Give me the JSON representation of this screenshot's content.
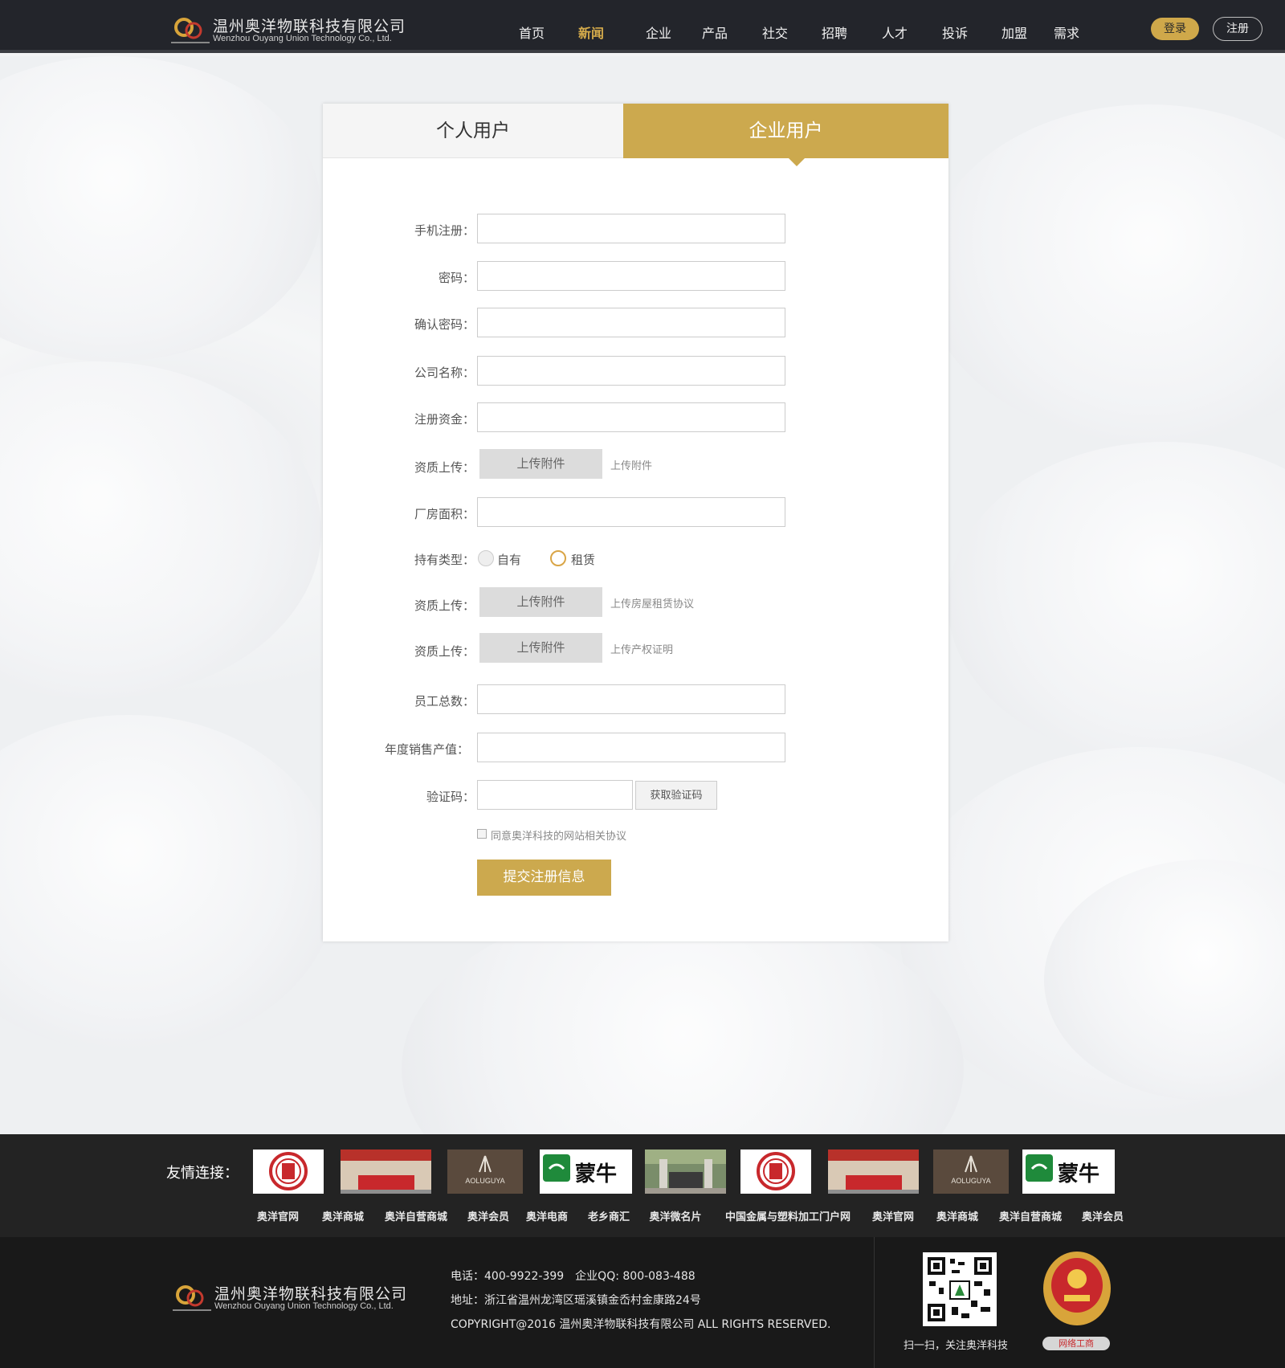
{
  "header": {
    "company_cn": "温州奥洋物联科技有限公司",
    "company_en": "Wenzhou Ouyang Union Technology Co., Ltd.",
    "nav": [
      "首页",
      "新闻",
      "企业",
      "产品",
      "社交",
      "招聘",
      "人才",
      "投诉",
      "加盟",
      "需求"
    ],
    "active_nav": "新闻",
    "login": "登录",
    "register": "注册"
  },
  "tabs": {
    "personal": "个人用户",
    "company": "企业用户",
    "active": "company"
  },
  "form": {
    "phone_label": "手机注册：",
    "password_label": "密码：",
    "confirm_label": "确认密码：",
    "company_name_label": "公司名称：",
    "capital_label": "注册资金：",
    "qual1_label": "资质上传：",
    "qual1_button": "上传附件",
    "qual1_hint": "上传附件",
    "area_label": "厂房面积：",
    "holding_label": "持有类型：",
    "holding_options": [
      "自有",
      "租赁"
    ],
    "holding_selected": "租赁",
    "qual2_label": "资质上传：",
    "qual2_button": "上传附件",
    "qual2_hint": "上传房屋租赁协议",
    "qual3_label": "资质上传：",
    "qual3_button": "上传附件",
    "qual3_hint": "上传产权证明",
    "staff_label": "员工总数：",
    "sales_label": "年度销售产值：",
    "captcha_label": "验证码：",
    "captcha_button": "获取验证码",
    "agree_text": "同意奥洋科技的网站相关协议",
    "agree_checked": false,
    "submit": "提交注册信息"
  },
  "links": {
    "title": "友情连接：",
    "names": [
      "奥洋官网",
      "奥洋商城",
      "奥洋自营商城",
      "奥洋会员",
      "奥洋电商",
      "老乡商汇",
      "奥洋微名片",
      "中国金属与塑料加工门户网",
      "奥洋官网",
      "奥洋商城",
      "奥洋自营商城",
      "奥洋会员"
    ],
    "logo_texts": {
      "aoluguya": "AOLUGUYA",
      "mengniu": "蒙牛"
    }
  },
  "footer": {
    "company_cn": "温州奥洋物联科技有限公司",
    "company_en": "Wenzhou Ouyang Union Technology Co., Ltd.",
    "phone_line": "电话：400-9922-399　企业QQ: 800-083-488",
    "address_line": "地址：浙江省温州龙湾区瑶溪镇金岙村金康路24号",
    "copyright_line": "COPYRIGHT@2016 温州奥洋物联科技有限公司 ALL RIGHTS RESERVED.",
    "qr_caption": "扫一扫，关注奥洋科技",
    "badge_caption": "网络工商"
  },
  "colors": {
    "accent": "#cca94e",
    "header_bg": "#23252b",
    "footer_bg": "#191919"
  }
}
